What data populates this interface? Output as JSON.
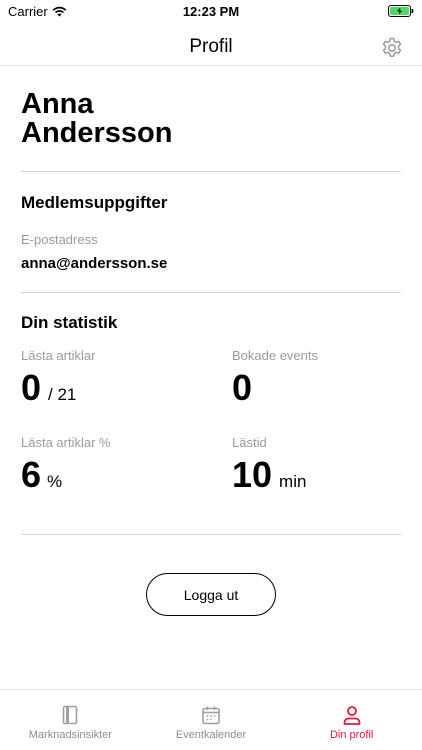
{
  "status_bar": {
    "carrier": "Carrier",
    "time": "12:23 PM"
  },
  "header": {
    "title": "Profil",
    "settings_icon": "gear-icon"
  },
  "profile": {
    "name": "Anna Andersson"
  },
  "member_details": {
    "title": "Medlemsuppgifter",
    "email_label": "E-postadress",
    "email_value": "anna@andersson.se"
  },
  "statistics": {
    "title": "Din statistik",
    "read_articles_label": "Lästa artiklar",
    "read_articles_value": "0",
    "read_articles_total": "/ 21",
    "booked_events_label": "Bokade events",
    "booked_events_value": "0",
    "read_percent_label": "Lästa artiklar %",
    "read_percent_value": "6",
    "read_percent_unit": "%",
    "read_time_label": "Lästid",
    "read_time_value": "10",
    "read_time_unit": "min"
  },
  "actions": {
    "logout_label": "Logga ut"
  },
  "tab_bar": {
    "tabs": [
      {
        "label": "Marknadsinsikter",
        "icon": "book-icon",
        "active": false
      },
      {
        "label": "Eventkalender",
        "icon": "calendar-icon",
        "active": false
      },
      {
        "label": "Din profil",
        "icon": "person-icon",
        "active": true
      }
    ]
  },
  "colors": {
    "accent": "#e31937",
    "muted_text": "#9b9b9b",
    "inactive_tab": "#8e8e93",
    "battery_charging": "#4cd964"
  }
}
